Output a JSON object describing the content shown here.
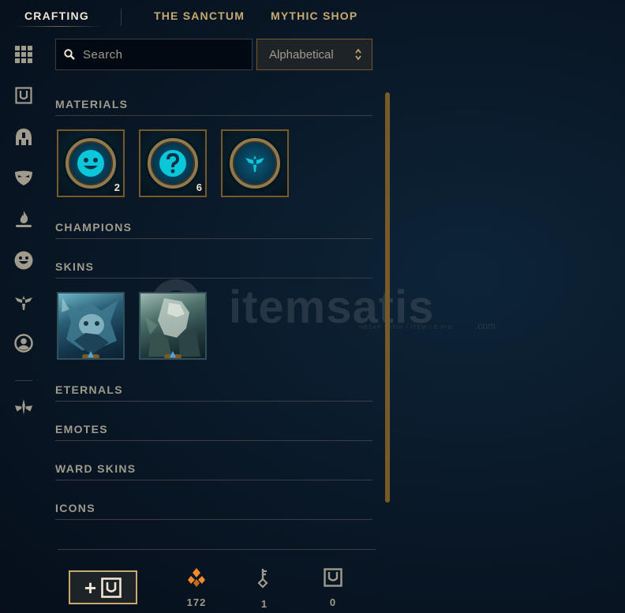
{
  "nav": {
    "tabs": [
      {
        "label": "CRAFTING",
        "active": true
      },
      {
        "label": "THE SANCTUM",
        "active": false
      },
      {
        "label": "MYTHIC SHOP",
        "active": false
      }
    ]
  },
  "sidebar": {
    "items": [
      {
        "icon": "grid-icon"
      },
      {
        "icon": "chest-icon"
      },
      {
        "icon": "helmet-icon"
      },
      {
        "icon": "mask-icon"
      },
      {
        "icon": "flame-icon"
      },
      {
        "icon": "emote-icon"
      },
      {
        "icon": "ward-icon"
      },
      {
        "icon": "profile-icon"
      },
      {
        "icon": "eternals-icon"
      }
    ],
    "help_label": "?"
  },
  "search": {
    "placeholder": "Search",
    "value": ""
  },
  "sort": {
    "selected": "Alphabetical"
  },
  "sections": {
    "materials": "MATERIALS",
    "champions": "CHAMPIONS",
    "skins": "SKINS",
    "eternals": "ETERNALS",
    "emotes": "EMOTES",
    "ward_skins": "WARD SKINS",
    "icons": "ICONS"
  },
  "materials": [
    {
      "icon": "emote-orb-icon",
      "count": "2"
    },
    {
      "icon": "mystery-orb-icon",
      "count": "6"
    },
    {
      "icon": "ward-orb-icon",
      "count": ""
    }
  ],
  "skins": [
    {
      "icon": "skin-shard-1",
      "rarity": "epic"
    },
    {
      "icon": "skin-shard-2",
      "rarity": "epic"
    }
  ],
  "watermark": {
    "text": "itemsatis",
    "sub": "HESAP SATIN / ITEM / E-PIN",
    "suffix": ".com"
  },
  "footer": {
    "add_key_label": "+",
    "currencies": [
      {
        "icon": "orange-essence-icon",
        "value": "172"
      },
      {
        "icon": "key-icon",
        "value": "1"
      },
      {
        "icon": "chest-icon",
        "value": "0"
      }
    ]
  },
  "colors": {
    "gold": "#c8aa6e",
    "border_gold": "#785a28",
    "text": "#a09b8c",
    "bright": "#f0e6d2",
    "hextech": "#0ac8b9"
  }
}
